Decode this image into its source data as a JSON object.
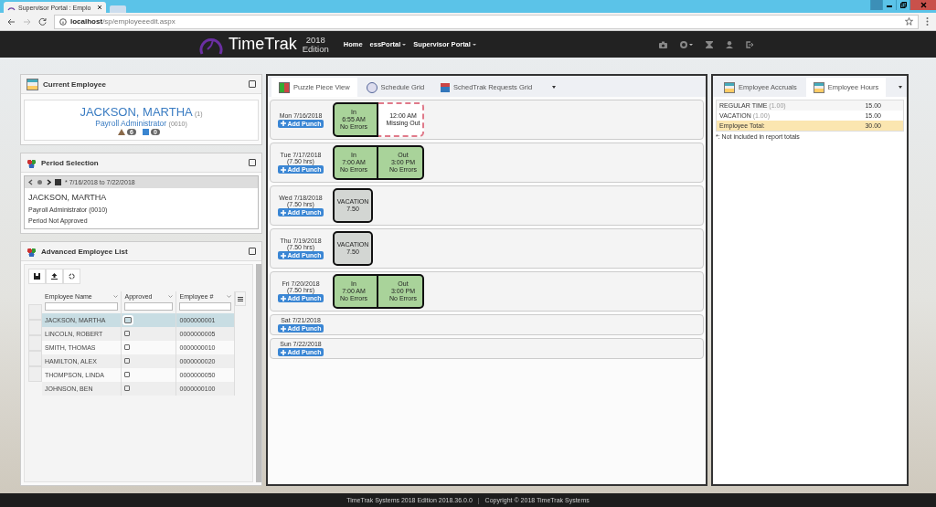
{
  "browser": {
    "tab_title": "Supervisor Portal : Emplo",
    "url_host": "localhost",
    "url_path": "/sp/employeeedit.aspx"
  },
  "navbar": {
    "brand": "TimeTrak",
    "edition_year": "2018",
    "edition_label": "Edition",
    "menu": [
      {
        "label": "Home",
        "dropdown": false
      },
      {
        "label": "essPortal",
        "dropdown": true
      },
      {
        "label": "Supervisor Portal",
        "dropdown": true
      }
    ]
  },
  "current_employee": {
    "title": "Current Employee",
    "name": "JACKSON, MARTHA",
    "number": "(1)",
    "position": "Payroll Administrator",
    "code": "(0010)",
    "warning_count": "6",
    "calendar_count": "0"
  },
  "period_selection": {
    "title": "Period Selection",
    "range": "* 7/16/2018 to 7/22/2018",
    "name": "JACKSON, MARTHA",
    "position": "Payroll Administrator (0010)",
    "status": "Period Not Approved"
  },
  "employee_list": {
    "title": "Advanced Employee List",
    "columns": [
      "Employee Name",
      "Approved",
      "Employee #"
    ],
    "rows": [
      {
        "name": "JACKSON, MARTHA",
        "approved": false,
        "number": "0000000001",
        "selected": true
      },
      {
        "name": "LINCOLN, ROBERT",
        "approved": false,
        "number": "0000000005",
        "selected": false
      },
      {
        "name": "SMITH, THOMAS",
        "approved": false,
        "number": "0000000010",
        "selected": false
      },
      {
        "name": "HAMILTON, ALEX",
        "approved": false,
        "number": "0000000020",
        "selected": false
      },
      {
        "name": "THOMPSON, LINDA",
        "approved": false,
        "number": "0000000050",
        "selected": false
      },
      {
        "name": "JOHNSON, BEN",
        "approved": false,
        "number": "0000000100",
        "selected": false
      }
    ]
  },
  "center_tabs": [
    {
      "label": "Puzzle Piece View",
      "selected": true
    },
    {
      "label": "Schedule Grid",
      "selected": false
    },
    {
      "label": "SchedTrak Requests Grid",
      "selected": false
    }
  ],
  "days": [
    {
      "date": "Mon 7/16/2018",
      "button": "Add Punch",
      "pieces": [
        {
          "kind": "in",
          "lines": [
            "In",
            "6:55 AM",
            "No Errors"
          ]
        },
        {
          "kind": "missing",
          "lines": [
            "12:00 AM",
            "Missing Out"
          ]
        }
      ]
    },
    {
      "date": "Tue 7/17/2018",
      "hours": "(7.50 hrs)",
      "button": "Add Punch",
      "pieces": [
        {
          "kind": "in",
          "lines": [
            "In",
            "7:00 AM",
            "No Errors"
          ]
        },
        {
          "kind": "out",
          "lines": [
            "Out",
            "3:00 PM",
            "No Errors"
          ]
        }
      ]
    },
    {
      "date": "Wed 7/18/2018",
      "hours": "(7.50 hrs)",
      "button": "Add Punch",
      "pieces": [
        {
          "kind": "vacation",
          "lines": [
            "VACATION",
            "7.50"
          ]
        }
      ]
    },
    {
      "date": "Thu 7/19/2018",
      "hours": "(7.50 hrs)",
      "button": "Add Punch",
      "pieces": [
        {
          "kind": "vacation",
          "lines": [
            "VACATION",
            "7.50"
          ]
        }
      ]
    },
    {
      "date": "Fri 7/20/2018",
      "hours": "(7.50 hrs)",
      "button": "Add Punch",
      "pieces": [
        {
          "kind": "in",
          "lines": [
            "In",
            "7:00 AM",
            "No Errors"
          ]
        },
        {
          "kind": "out",
          "lines": [
            "Out",
            "3:00 PM",
            "No Errors"
          ]
        }
      ]
    },
    {
      "date": "Sat 7/21/2018",
      "button": "Add Punch"
    },
    {
      "date": "Sun 7/22/2018",
      "button": "Add Punch"
    }
  ],
  "right_tabs": [
    {
      "label": "Employee Accruals",
      "selected": false
    },
    {
      "label": "Employee Hours",
      "selected": true
    }
  ],
  "hours_rows": [
    {
      "label": "REGULAR TIME",
      "factor": "(1.00)",
      "value": "15.00",
      "kind": "line"
    },
    {
      "label": "VACATION",
      "factor": "(1.00)",
      "value": "15.00",
      "kind": "line"
    },
    {
      "label": "Employee Total:",
      "value": "30.00",
      "kind": "total"
    }
  ],
  "hours_note": "*: Not included in report totals",
  "footer": {
    "version": "TimeTrak Systems 2018 Edition 2018.36.0.0",
    "separator": "|",
    "copyright": "Copyright © 2018 TimeTrak Systems"
  }
}
